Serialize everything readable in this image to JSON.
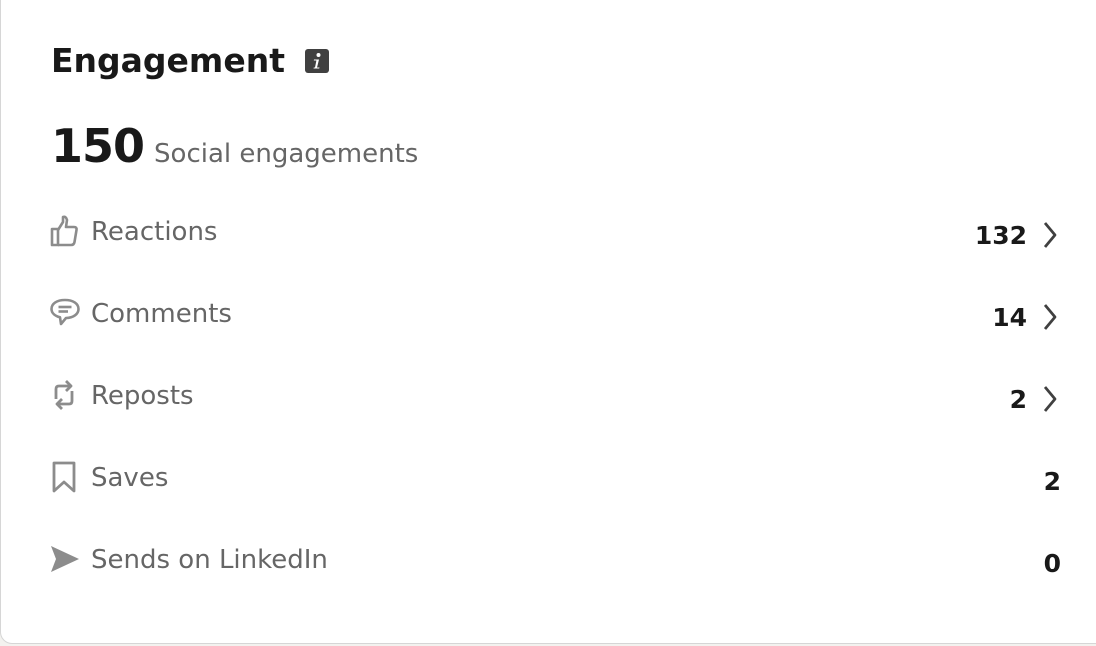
{
  "engagement": {
    "title": "Engagement",
    "total_value": "150",
    "total_label": "Social engagements",
    "info_icon": "info-icon",
    "rows": [
      {
        "label": "Reactions",
        "value": "132",
        "icon": "thumbs-up-icon",
        "has_chevron": true
      },
      {
        "label": "Comments",
        "value": "14",
        "icon": "comment-icon",
        "has_chevron": true
      },
      {
        "label": "Reposts",
        "value": "2",
        "icon": "repost-icon",
        "has_chevron": true
      },
      {
        "label": "Saves",
        "value": "2",
        "icon": "bookmark-icon",
        "has_chevron": false
      },
      {
        "label": "Sends on LinkedIn",
        "value": "0",
        "icon": "send-icon",
        "has_chevron": false
      }
    ]
  },
  "colors": {
    "primary_text": "#191919",
    "secondary_text": "#666666",
    "icon_gray": "#8c8c8c",
    "card_border": "#d6d6d6"
  }
}
